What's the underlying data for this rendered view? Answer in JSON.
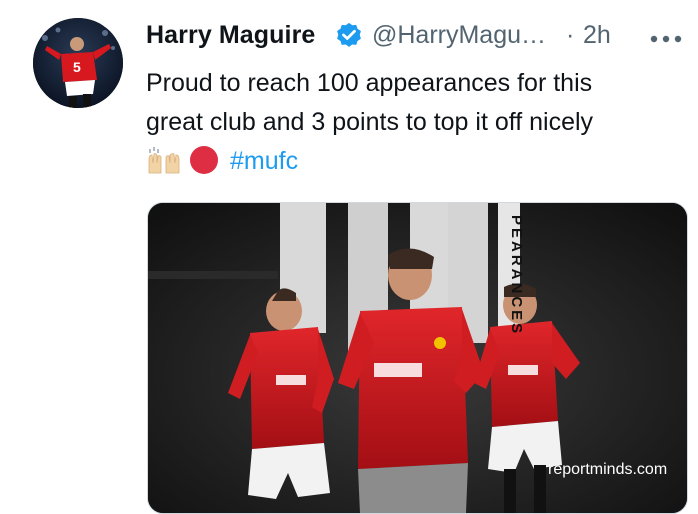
{
  "tweet": {
    "author": {
      "display_name": "Harry Maguire",
      "handle": "@HarryMagu…",
      "verified": true
    },
    "separator": "·",
    "timestamp": "2h",
    "text_lines": [
      "Proud to reach 100 appearances for this",
      "great club and 3 points to top it off nicely"
    ],
    "emojis": [
      "raising-hands-emoji",
      "red-circle-emoji"
    ],
    "hashtag": "#mufc",
    "media": {
      "vertical_text": "PEARANCES",
      "watermark": "reportminds.com"
    }
  },
  "colors": {
    "text": "#0f1419",
    "secondary": "#536471",
    "link": "#1d9bf0",
    "verified": "#1d9bf0",
    "jersey_red": "#d7191f"
  },
  "icons": {
    "verified": "verified-badge-icon",
    "more": "more-options-icon"
  }
}
